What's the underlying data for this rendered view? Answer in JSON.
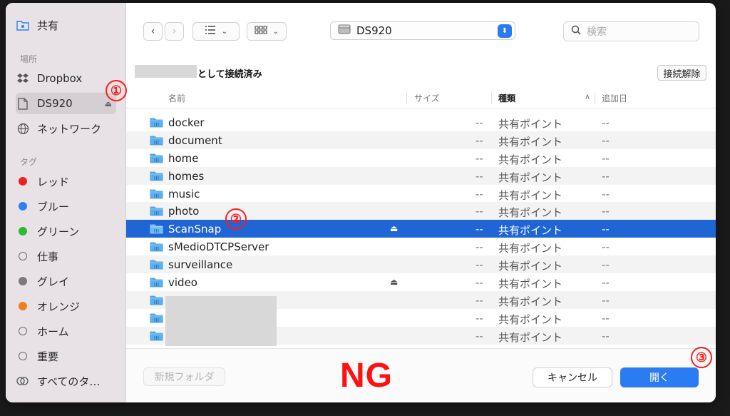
{
  "sidebar": {
    "shared_label": "共有",
    "places_header": "場所",
    "places": [
      {
        "label": "Dropbox",
        "icon": "dropbox-icon"
      },
      {
        "label": "DS920",
        "icon": "document-icon"
      },
      {
        "label": "ネットワーク",
        "icon": "globe-icon"
      }
    ],
    "tags_header": "タグ",
    "tags": [
      {
        "label": "レッド",
        "color": "#ee2020"
      },
      {
        "label": "ブルー",
        "color": "#2f7ff0"
      },
      {
        "label": "グリーン",
        "color": "#2bbb2b"
      },
      {
        "label": "仕事",
        "color": ""
      },
      {
        "label": "グレイ",
        "color": "#7a7a7a"
      },
      {
        "label": "オレンジ",
        "color": "#f07f1a"
      },
      {
        "label": "ホーム",
        "color": ""
      },
      {
        "label": "重要",
        "color": ""
      },
      {
        "label": "すべてのタ…",
        "color": ""
      }
    ]
  },
  "toolbar": {
    "location": "DS920",
    "search_placeholder": "検索"
  },
  "connection": {
    "label": "として接続済み",
    "disconnect": "接続解除"
  },
  "columns": {
    "name": "名前",
    "size": "サイズ",
    "kind": "種類",
    "added": "追加日"
  },
  "files": [
    {
      "name": "docker",
      "size": "--",
      "kind": "共有ポイント",
      "added": "--"
    },
    {
      "name": "document",
      "size": "--",
      "kind": "共有ポイント",
      "added": "--"
    },
    {
      "name": "home",
      "size": "--",
      "kind": "共有ポイント",
      "added": "--"
    },
    {
      "name": "homes",
      "size": "--",
      "kind": "共有ポイント",
      "added": "--"
    },
    {
      "name": "music",
      "size": "--",
      "kind": "共有ポイント",
      "added": "--"
    },
    {
      "name": "photo",
      "size": "--",
      "kind": "共有ポイント",
      "added": "--"
    },
    {
      "name": "ScanSnap",
      "size": "--",
      "kind": "共有ポイント",
      "added": "--"
    },
    {
      "name": "sMedioDTCPServer",
      "size": "--",
      "kind": "共有ポイント",
      "added": "--"
    },
    {
      "name": "surveillance",
      "size": "--",
      "kind": "共有ポイント",
      "added": "--"
    },
    {
      "name": "video",
      "size": "--",
      "kind": "共有ポイント",
      "added": "--"
    },
    {
      "name": "",
      "size": "--",
      "kind": "共有ポイント",
      "added": "--"
    },
    {
      "name": "",
      "size": "--",
      "kind": "共有ポイント",
      "added": "--"
    },
    {
      "name": "",
      "size": "--",
      "kind": "共有ポイント",
      "added": "--"
    }
  ],
  "footer": {
    "new_folder": "新規フォルダ",
    "cancel": "キャンセル",
    "open": "開く",
    "ng_label": "NG"
  },
  "annotations": [
    "①",
    "②",
    "③"
  ],
  "colors": {
    "selection": "#1f65d6",
    "accent": "#2b7cf2",
    "annotation": "#ff1a1a"
  }
}
